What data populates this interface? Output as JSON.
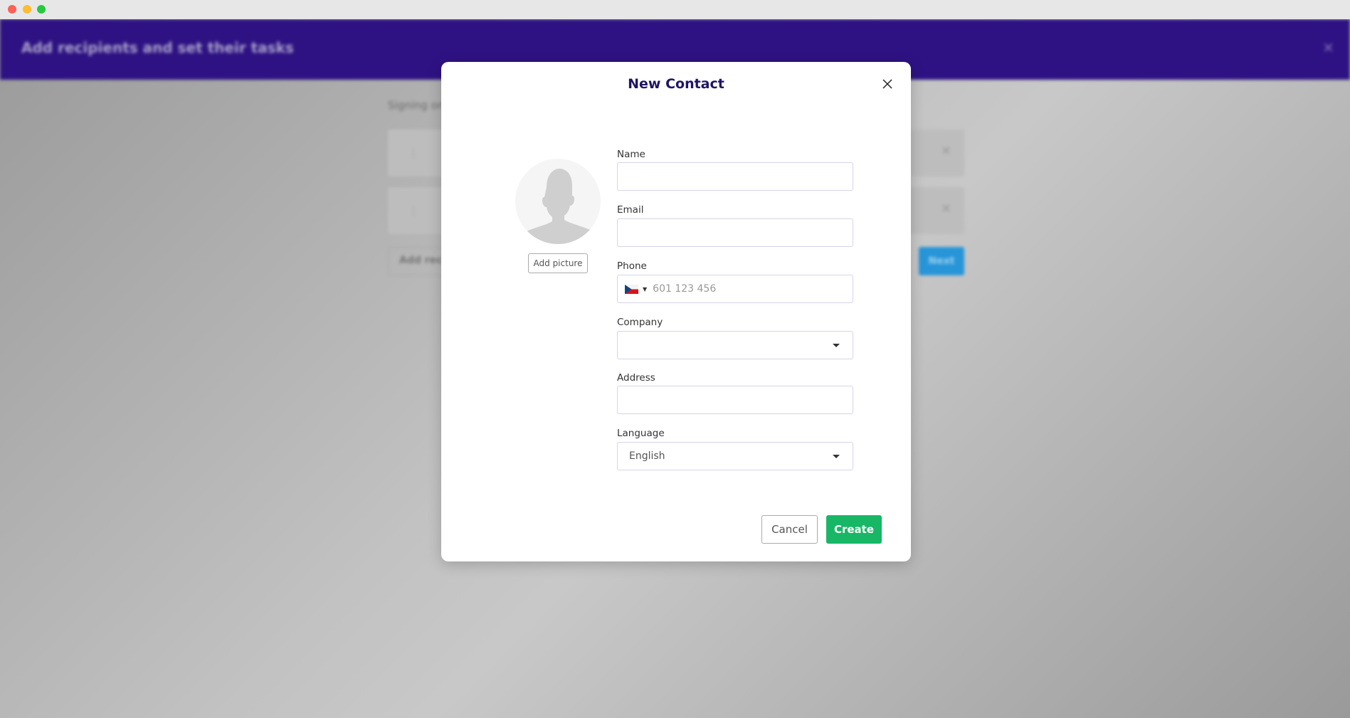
{
  "window": {
    "controls": [
      "close",
      "minimize",
      "maximize"
    ]
  },
  "background": {
    "header_title": "Add recipients and set their tasks",
    "signing_order_label": "Signing order",
    "add_recipient_label": "Add recipient",
    "next_label": "Next",
    "brand_color": "#2e1283"
  },
  "modal": {
    "title": "New Contact",
    "add_picture_label": "Add picture",
    "fields": {
      "name": {
        "label": "Name",
        "value": ""
      },
      "email": {
        "label": "Email",
        "value": ""
      },
      "phone": {
        "label": "Phone",
        "country": "CZ",
        "placeholder": "601 123 456",
        "value": ""
      },
      "company": {
        "label": "Company",
        "value": ""
      },
      "address": {
        "label": "Address",
        "value": ""
      },
      "language": {
        "label": "Language",
        "value": "English"
      }
    },
    "cancel_label": "Cancel",
    "create_label": "Create",
    "create_color": "#17b766"
  }
}
